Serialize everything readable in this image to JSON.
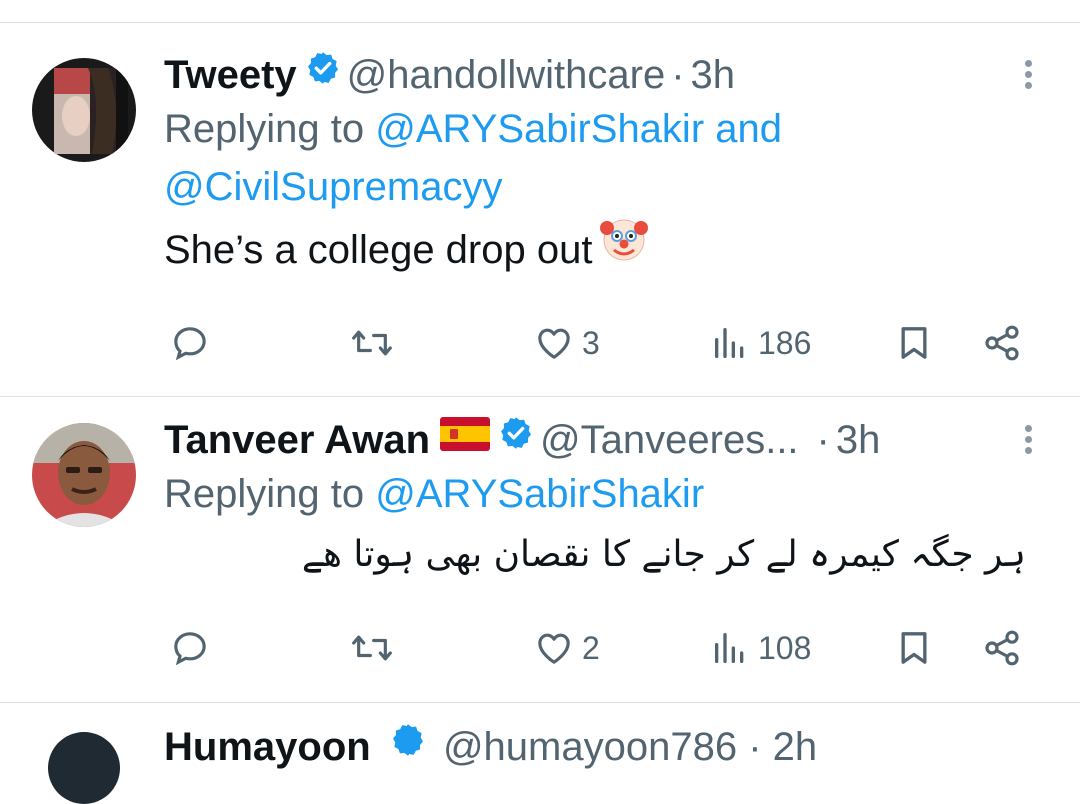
{
  "tweets": [
    {
      "name": "Tweety",
      "handle": "@handollwithcare",
      "separator": "·",
      "time": "3h",
      "replying_prefix": "Replying to",
      "replying_to_1": "@ARYSabirShakir",
      "replying_and": "and",
      "replying_to_2": "@CivilSupremacyy",
      "text": "She’s a college drop out",
      "emoji": "clown-face",
      "stats": {
        "replies": "",
        "retweets": "",
        "likes": "3",
        "views": "186"
      }
    },
    {
      "name": "Tanveer Awan",
      "flag": "spain-flag",
      "handle": "@Tanveeres...",
      "separator": "·",
      "time": "3h",
      "replying_prefix": "Replying to",
      "replying_to_1": "@ARYSabirShakir",
      "text": "ہر جگہ کیمرہ لے کر جانے کا نقصان بھی ہوتا ھے",
      "stats": {
        "replies": "",
        "retweets": "",
        "likes": "2",
        "views": "108"
      }
    }
  ],
  "partial": {
    "name": "Humayoon",
    "handle": "@humayoon786",
    "separator": "·",
    "time": "2h"
  },
  "colors": {
    "accent": "#1d9bf0",
    "muted": "#536471",
    "text": "#0f1419",
    "divider": "#dfe3e6"
  }
}
